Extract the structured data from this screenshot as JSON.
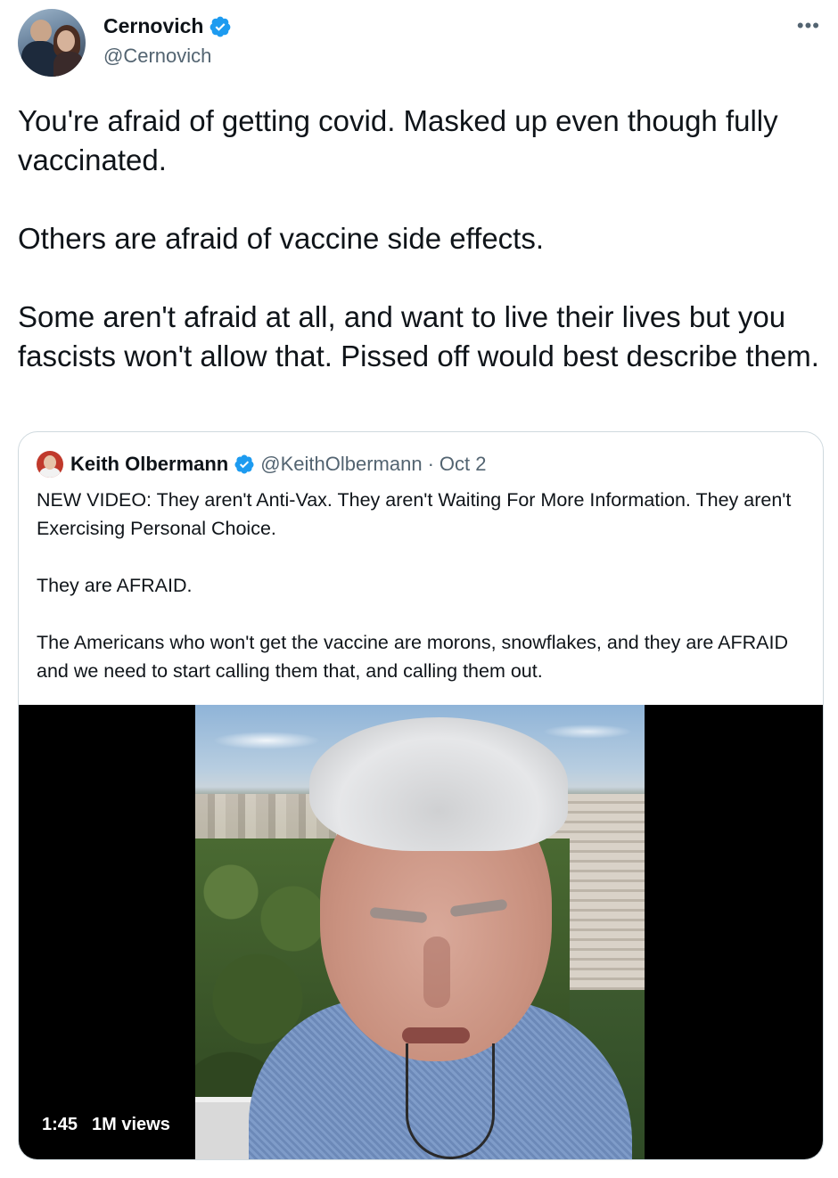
{
  "tweet": {
    "author": {
      "display_name": "Cernovich",
      "handle": "@Cernovich",
      "verified": true
    },
    "more_icon": "•••",
    "text_paragraphs": [
      "You're afraid of getting covid. Masked up even though fully vaccinated.",
      "Others are afraid of vaccine side effects.",
      "Some aren't afraid at all, and want to live their lives but you fascists won't allow that. Pissed off would best describe them."
    ]
  },
  "quoted_tweet": {
    "author": {
      "display_name": "Keith Olbermann",
      "handle": "@KeithOlbermann",
      "verified": true
    },
    "separator": "·",
    "date": "Oct 2",
    "text_paragraphs": [
      "NEW VIDEO: They aren't Anti-Vax. They aren't Waiting For More Information. They aren't Exercising Personal Choice.",
      "They are AFRAID.",
      "The Americans who won't get the vaccine are morons, snowflakes, and they are AFRAID and we need to start calling them that, and calling them out."
    ],
    "video": {
      "duration": "1:45",
      "views": "1M views"
    }
  },
  "colors": {
    "verified_blue": "#1d9bf0",
    "secondary_text": "#536471",
    "border": "#cfd9de"
  }
}
